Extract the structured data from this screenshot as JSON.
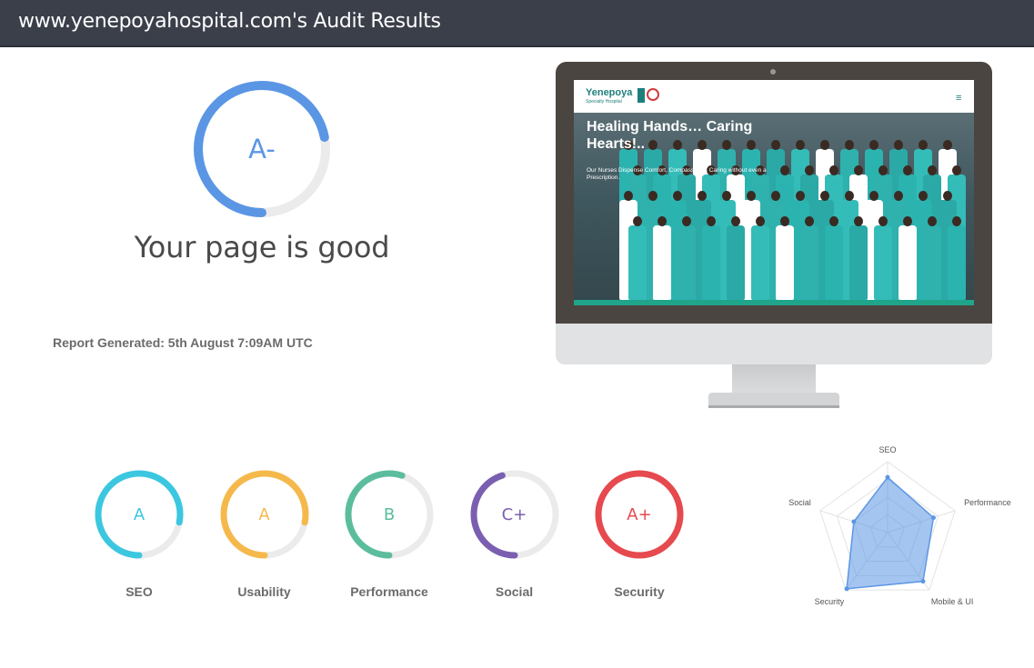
{
  "header": {
    "title": "www.yenepoyahospital.com's Audit Results"
  },
  "overall": {
    "grade": "A-",
    "score_fraction": 0.72,
    "color": "#5b96e5",
    "verdict": "Your page is good",
    "report_generated": "Report Generated: 5th August 7:09AM UTC"
  },
  "preview": {
    "site_logo": "Yenepoya",
    "site_logo_sub": "Specialty Hospital",
    "menu_icon": "hamburger-icon",
    "hero_title": "Healing Hands… Caring Hearts!..",
    "hero_subtitle": "Our Nurses Dispense Comfort, Compassion & Caring without even a Prescription."
  },
  "categories": [
    {
      "label": "SEO",
      "grade": "A",
      "score_fraction": 0.78,
      "color": "#3cc7e0"
    },
    {
      "label": "Usability",
      "grade": "A",
      "score_fraction": 0.78,
      "color": "#f5b94b"
    },
    {
      "label": "Performance",
      "grade": "B",
      "score_fraction": 0.55,
      "color": "#5bbd9e"
    },
    {
      "label": "Social",
      "grade": "C+",
      "score_fraction": 0.45,
      "color": "#7a5fb1"
    },
    {
      "label": "Security",
      "grade": "A+",
      "score_fraction": 1.0,
      "color": "#e6494e"
    }
  ],
  "chart_data": {
    "type": "radar",
    "axes": [
      "SEO",
      "Performance",
      "Mobile & UI",
      "Security",
      "Social"
    ],
    "values": [
      0.78,
      0.68,
      0.85,
      0.98,
      0.5
    ],
    "range": [
      0,
      1
    ],
    "fill_color": "#5b96e5"
  }
}
